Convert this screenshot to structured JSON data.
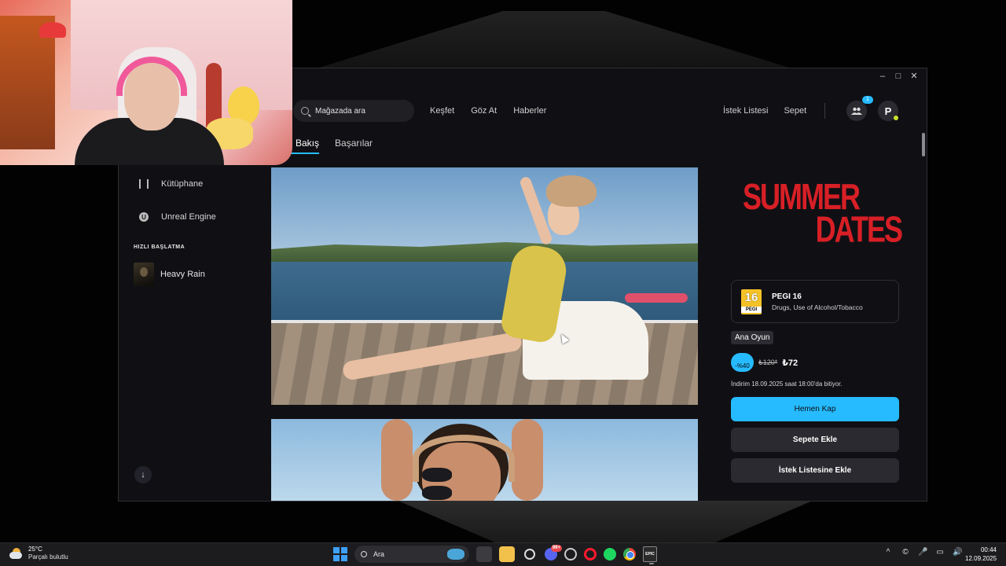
{
  "window": {
    "controls": {
      "minimize": "–",
      "maximize": "□",
      "close": "✕"
    }
  },
  "nav": {
    "search_placeholder": "Mağazada ara",
    "links": [
      "Keşfet",
      "Göz At",
      "Haberler"
    ],
    "wishlist": "İstek Listesi",
    "cart": "Sepet",
    "friends_badge": "1",
    "profile_initial": "P"
  },
  "subtabs": [
    "l Bakış",
    "Başarılar"
  ],
  "sidebar": {
    "items": [
      {
        "label": "Kütüphane",
        "icon": "library-icon"
      },
      {
        "label": "Unreal Engine",
        "icon": "unreal-engine-icon",
        "glyph": "U"
      }
    ],
    "quick_launch_header": "HIZLI BAŞLATMA",
    "quick_launch": [
      {
        "label": "Heavy Rain"
      }
    ],
    "download_icon": "↓"
  },
  "game": {
    "logo_line1": "SUMMER",
    "logo_line2": "DATES",
    "logo_color": "#d81f26",
    "rating": {
      "badge_number": "16",
      "badge_text": "PEGI",
      "title": "PEGI 16",
      "descriptors": "Drugs, Use of Alcohol/Tobacco"
    },
    "edition": "Ana Oyun",
    "discount": "-%40",
    "old_price": "₺120*",
    "new_price": "₺72",
    "sale_end": "İndirim 18.09.2025 saat 18:00'da bitiyor.",
    "buttons": {
      "buy": "Hemen Kap",
      "add_to_cart": "Sepete Ekle",
      "add_to_wishlist": "İstek Listesine Ekle"
    },
    "accent_color": "#26bbff"
  },
  "taskbar": {
    "weather": {
      "temp": "25°C",
      "desc": "Parçalı bulutlu"
    },
    "search_label": "Ara",
    "discord_badge": "99+",
    "clock": {
      "time": "00:44",
      "date": "12.09.2025"
    },
    "epic_label": "EPIC",
    "tray": [
      "^",
      "©",
      "🎤",
      "▭",
      "🔊"
    ]
  }
}
